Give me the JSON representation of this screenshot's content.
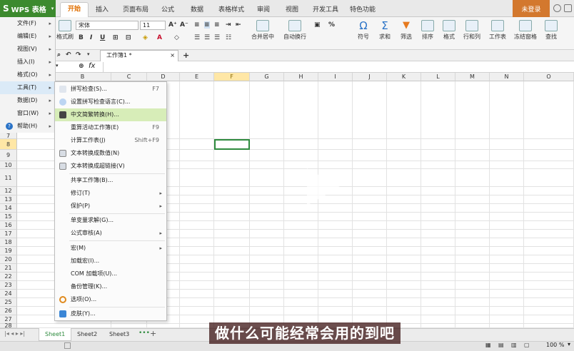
{
  "app": {
    "brand": "WPS 表格",
    "login_label": "未登录"
  },
  "tabs": [
    {
      "label": "开始"
    },
    {
      "label": "插入"
    },
    {
      "label": "页面布局"
    },
    {
      "label": "公式"
    },
    {
      "label": "数据"
    },
    {
      "label": "表格样式"
    },
    {
      "label": "审阅"
    },
    {
      "label": "视图"
    },
    {
      "label": "开发工具"
    },
    {
      "label": "特色功能"
    }
  ],
  "ribbon": {
    "format_painter": "格式刷",
    "font_name": "宋体",
    "font_size": "11",
    "merge_center": "合并居中",
    "auto_wrap": "自动换行",
    "symbol": "符号",
    "sum": "求和",
    "filter": "筛选",
    "sort": "排序",
    "format": "格式",
    "rows_cols": "行和列",
    "worksheet": "工作表",
    "freeze": "冻结窗格",
    "find": "查找",
    "percent": "%"
  },
  "document": {
    "tab_label": "工作簿1 *"
  },
  "formula_bar": {
    "fx": "fx"
  },
  "columns": [
    "B",
    "C",
    "D",
    "E",
    "F",
    "G",
    "H",
    "I",
    "J",
    "K",
    "L",
    "M",
    "N",
    "O"
  ],
  "rows": [
    "7",
    "8",
    "9",
    "10",
    "11",
    "12",
    "13",
    "14",
    "15",
    "16",
    "17",
    "18",
    "19",
    "20",
    "21",
    "22",
    "23",
    "24",
    "25",
    "26",
    "27",
    "28"
  ],
  "left_menu": [
    {
      "label": "文件(F)"
    },
    {
      "label": "编辑(E)"
    },
    {
      "label": "视图(V)"
    },
    {
      "label": "插入(I)"
    },
    {
      "label": "格式(O)"
    },
    {
      "label": "工具(T)"
    },
    {
      "label": "数据(D)"
    },
    {
      "label": "窗口(W)"
    },
    {
      "label": "帮助(H)"
    }
  ],
  "tools_menu": [
    {
      "label": "拼写检查(S)...",
      "shortcut": "F7"
    },
    {
      "label": "设置拼写检查语言(C)...",
      "shortcut": ""
    },
    {
      "label": "中文简繁转换(H)...",
      "shortcut": ""
    },
    {
      "label": "重算活动工作簿(E)",
      "shortcut": "F9"
    },
    {
      "label": "计算工作表(J)",
      "shortcut": "Shift+F9"
    },
    {
      "label": "文本转换成数值(N)",
      "shortcut": ""
    },
    {
      "label": "文本转换成超链接(V)",
      "shortcut": ""
    },
    {
      "label": "共享工作簿(B)...",
      "shortcut": ""
    },
    {
      "label": "修订(T)",
      "shortcut": ""
    },
    {
      "label": "保护(P)",
      "shortcut": ""
    },
    {
      "label": "单变量求解(G)...",
      "shortcut": ""
    },
    {
      "label": "公式审核(A)",
      "shortcut": ""
    },
    {
      "label": "宏(M)",
      "shortcut": ""
    },
    {
      "label": "加载宏(I)...",
      "shortcut": ""
    },
    {
      "label": "COM 加载项(U)...",
      "shortcut": ""
    },
    {
      "label": "备份管理(K)...",
      "shortcut": ""
    },
    {
      "label": "选项(O)...",
      "shortcut": ""
    },
    {
      "label": "皮肤(Y)...",
      "shortcut": ""
    }
  ],
  "sheets": [
    {
      "label": "Sheet1"
    },
    {
      "label": "Sheet2"
    },
    {
      "label": "Sheet3"
    }
  ],
  "status": {
    "zoom": "100 %"
  },
  "video_subtitle": "做什么可能经常会用的到吧"
}
